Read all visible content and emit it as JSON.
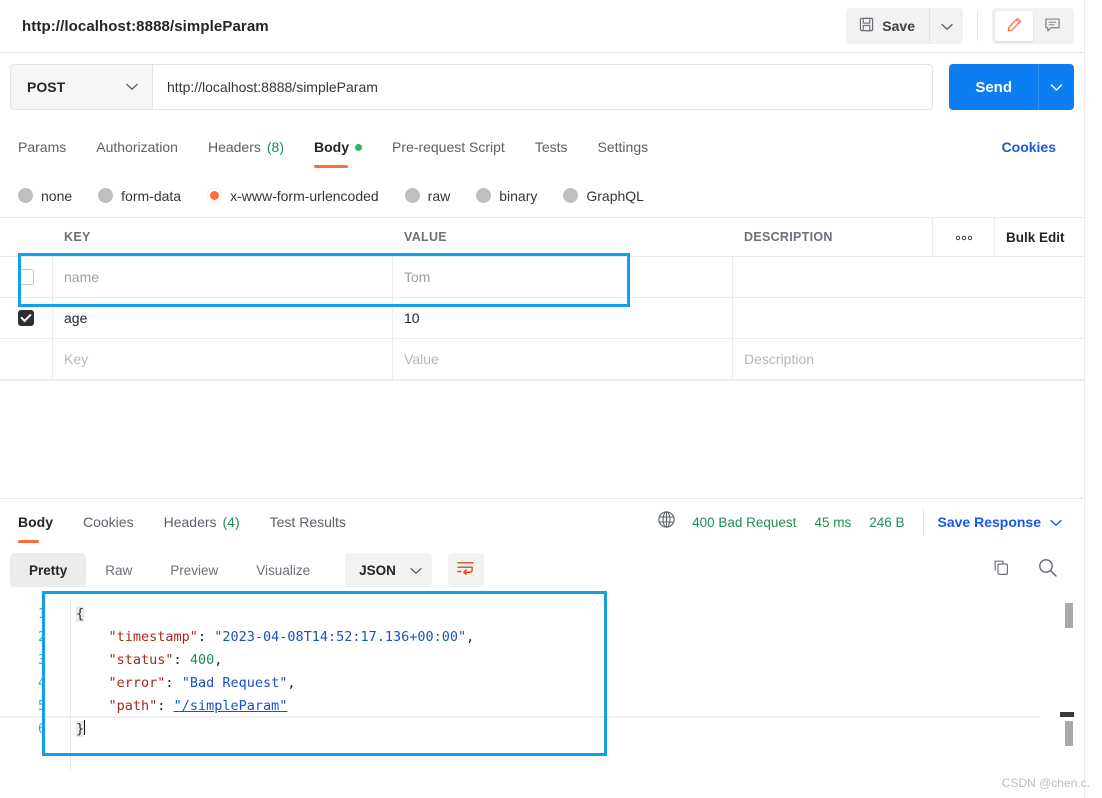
{
  "titlebar": {
    "tab_title": "http://localhost:8888/simpleParam",
    "save_label": "Save",
    "save_icon": "floppy-disk-icon",
    "save_caret_icon": "chevron-down-icon",
    "edit_icon": "pencil-icon",
    "comment_icon": "comment-icon"
  },
  "request": {
    "method": "POST",
    "method_caret_icon": "chevron-down-icon",
    "url": "http://localhost:8888/simpleParam",
    "send_label": "Send",
    "send_caret_icon": "chevron-down-icon"
  },
  "request_tabs": {
    "items": [
      {
        "label": "Params",
        "count": "",
        "active": false
      },
      {
        "label": "Authorization",
        "count": "",
        "active": false
      },
      {
        "label": "Headers",
        "count": "(8)",
        "active": false
      },
      {
        "label": "Body",
        "count": "",
        "active": true,
        "dot": true
      },
      {
        "label": "Pre-request Script",
        "count": "",
        "active": false
      },
      {
        "label": "Tests",
        "count": "",
        "active": false
      },
      {
        "label": "Settings",
        "count": "",
        "active": false
      }
    ],
    "cookies_link": "Cookies"
  },
  "body_types": {
    "options": [
      {
        "label": "none",
        "selected": false
      },
      {
        "label": "form-data",
        "selected": false
      },
      {
        "label": "x-www-form-urlencoded",
        "selected": true
      },
      {
        "label": "raw",
        "selected": false
      },
      {
        "label": "binary",
        "selected": false
      },
      {
        "label": "GraphQL",
        "selected": false
      }
    ]
  },
  "kv_table": {
    "columns": [
      "KEY",
      "VALUE",
      "DESCRIPTION"
    ],
    "more_icon": "ellipsis-icon",
    "bulk_edit_label": "Bulk Edit",
    "rows": [
      {
        "checked": false,
        "key": "name",
        "value": "Tom",
        "description": "",
        "muted": true,
        "highlighted": true
      },
      {
        "checked": true,
        "key": "age",
        "value": "10",
        "description": "",
        "muted": false,
        "highlighted": false
      }
    ],
    "new_row": {
      "key_placeholder": "Key",
      "value_placeholder": "Value",
      "description_placeholder": "Description"
    }
  },
  "response": {
    "tabs": [
      {
        "label": "Body",
        "count": "",
        "active": true
      },
      {
        "label": "Cookies",
        "count": "",
        "active": false
      },
      {
        "label": "Headers",
        "count": "(4)",
        "active": false
      },
      {
        "label": "Test Results",
        "count": "",
        "active": false
      }
    ],
    "globe_icon": "globe-icon",
    "status": "400 Bad Request",
    "time": "45 ms",
    "size": "246 B",
    "save_response_label": "Save Response",
    "save_response_caret_icon": "chevron-down-icon",
    "view_tabs": [
      {
        "label": "Pretty",
        "active": true
      },
      {
        "label": "Raw",
        "active": false
      },
      {
        "label": "Preview",
        "active": false
      },
      {
        "label": "Visualize",
        "active": false
      }
    ],
    "format": "JSON",
    "format_caret_icon": "chevron-down-icon",
    "wrap_icon": "word-wrap-icon",
    "copy_icon": "copy-icon",
    "search_icon": "search-icon",
    "line_numbers": [
      "1",
      "2",
      "3",
      "4",
      "5",
      "6"
    ],
    "body_lines": [
      {
        "n": "1",
        "text": "{"
      },
      {
        "n": "2",
        "key": "\"timestamp\"",
        "sep": ": ",
        "val": "\"2023-04-08T14:52:17.136+00:00\"",
        "type": "string",
        "tail": ","
      },
      {
        "n": "3",
        "key": "\"status\"",
        "sep": ": ",
        "val": "400",
        "type": "number",
        "tail": ","
      },
      {
        "n": "4",
        "key": "\"error\"",
        "sep": ": ",
        "val": "\"Bad Request\"",
        "type": "string",
        "tail": ","
      },
      {
        "n": "5",
        "key": "\"path\"",
        "sep": ": ",
        "val": "\"/simpleParam\"",
        "type": "link",
        "tail": ""
      },
      {
        "n": "6",
        "text": "}"
      }
    ]
  },
  "colors": {
    "accent_orange": "#ff6c37",
    "send_blue": "#0c7ef2",
    "link_blue": "#1858e8",
    "status_green": "#1e8e57",
    "highlight_blue": "#12a0e8"
  },
  "watermark": "CSDN @chen.c."
}
